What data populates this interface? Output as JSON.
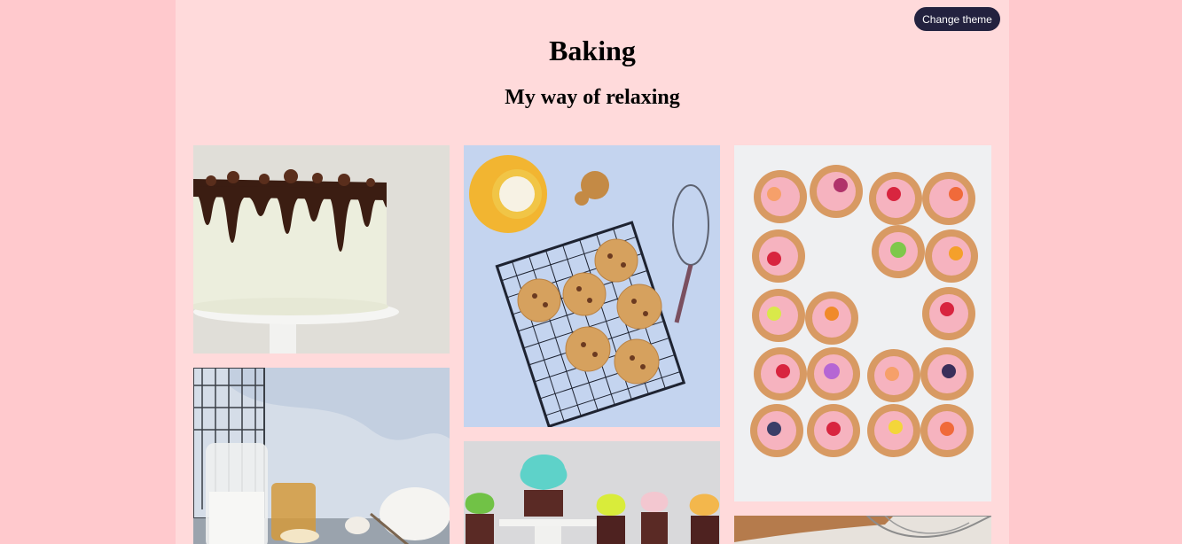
{
  "header": {
    "title": "Baking",
    "subtitle": "My way of relaxing",
    "theme_button_label": "Change theme"
  },
  "gallery": {
    "images": [
      {
        "name": "drip-cake-photo"
      },
      {
        "name": "cookies-on-rack-photo"
      },
      {
        "name": "fruit-donuts-photo"
      },
      {
        "name": "baking-ingredients-photo"
      },
      {
        "name": "cupcakes-photo"
      },
      {
        "name": "rolling-pin-whisk-photo"
      }
    ]
  },
  "colors": {
    "background": "#ffc9cd",
    "page": "#ffdadb",
    "button": "#23223f"
  }
}
